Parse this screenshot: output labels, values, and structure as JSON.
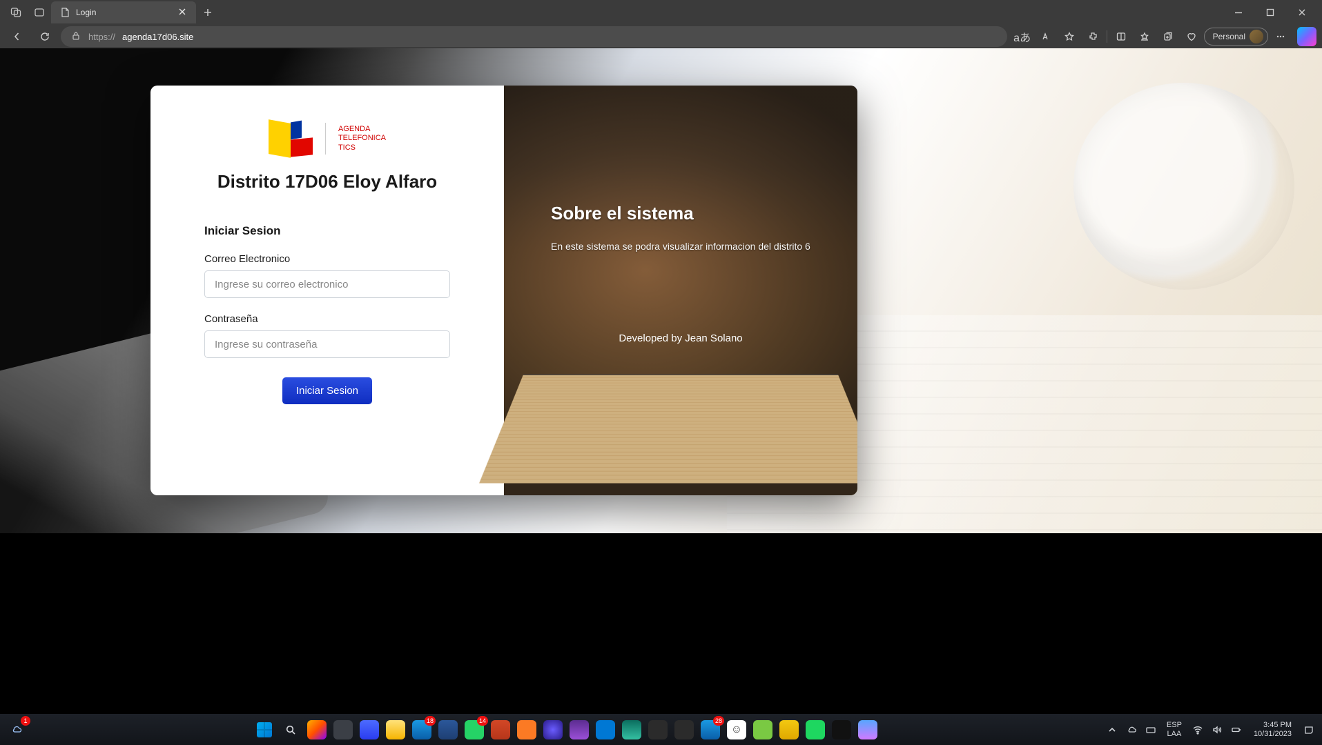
{
  "browser": {
    "tab_title": "Login",
    "url_prefix": "https://",
    "url_host": "agenda17d06.site",
    "profile_label": "Personal"
  },
  "page": {
    "logo_text_line1": "AGENDA",
    "logo_text_line2": "TELEFONICA",
    "logo_text_line3": "TICS",
    "title": "Distrito 17D06 Eloy Alfaro",
    "login_heading": "Iniciar Sesion",
    "email_label": "Correo Electronico",
    "email_placeholder": "Ingrese su correo electronico",
    "password_label": "Contraseña",
    "password_placeholder": "Ingrese su contraseña",
    "login_button": "Iniciar Sesion",
    "about_heading": "Sobre el sistema",
    "about_text": "En este sistema se podra visualizar informacion del distrito 6",
    "credit": "Developed by Jean Solano"
  },
  "taskbar": {
    "lang_top": "ESP",
    "lang_bottom": "LAA",
    "time": "3:45 PM",
    "date": "10/31/2023",
    "badges": {
      "outlook": "18",
      "whatsapp": "14",
      "calendar": "28",
      "weather": "1"
    }
  }
}
